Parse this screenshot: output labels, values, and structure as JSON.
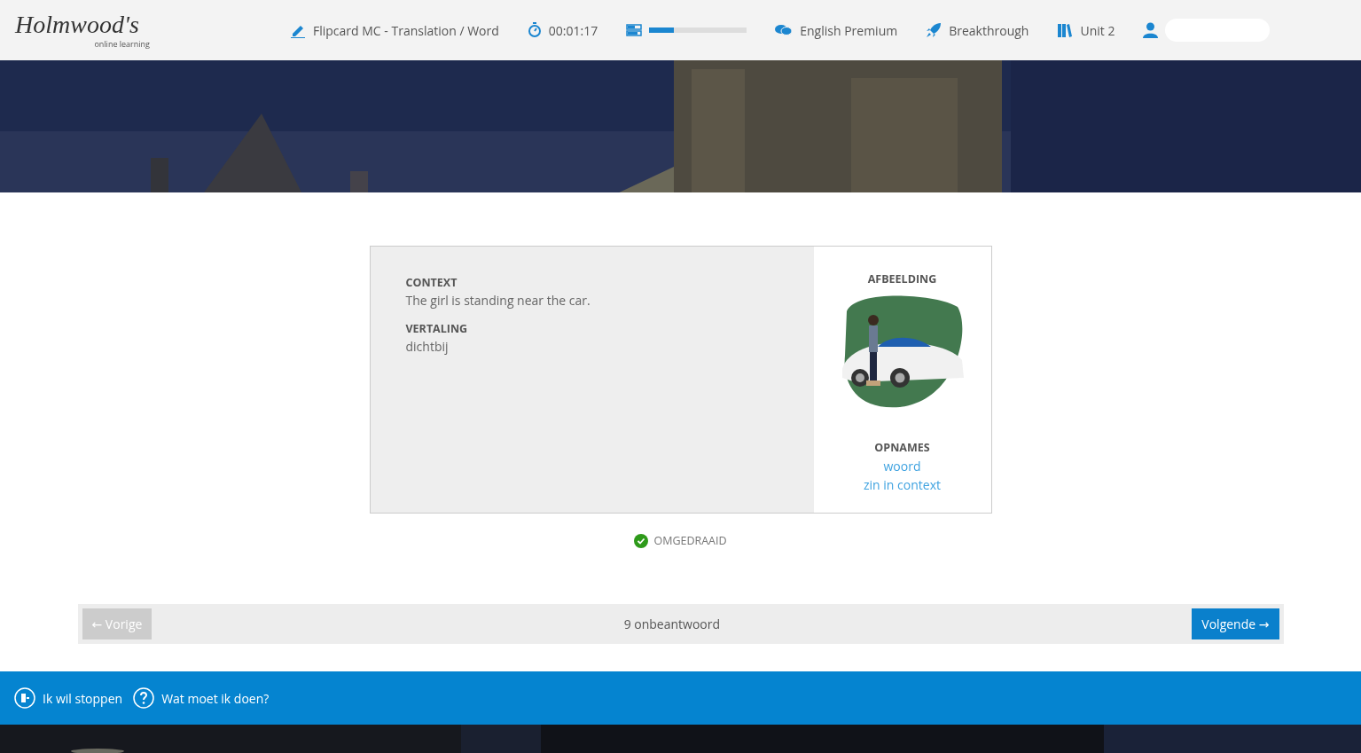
{
  "logo": {
    "name": "Holmwood's",
    "tagline": "online learning"
  },
  "header": {
    "exercise": "Flipcard MC - Translation / Word",
    "timer": "00:01:17",
    "progress": {
      "level": 0.25
    },
    "course": "English Premium",
    "level_name": "Breakthrough",
    "unit": "Unit 2",
    "user": {
      "redacted": true
    }
  },
  "card": {
    "sections": [
      {
        "heading": "CONTEXT",
        "text": "The girl is standing near the car."
      },
      {
        "heading": "VERTALING",
        "text": "dichtbij"
      }
    ],
    "image_heading": "AFBEELDING",
    "recordings_heading": "OPNAMES",
    "recordings": [
      "woord",
      "zin in context"
    ]
  },
  "status": {
    "label": "OMGEDRAAID",
    "checked": true
  },
  "navigation": {
    "previous": {
      "label": "← Vorige",
      "disabled": true
    },
    "counter": "9 onbeantwoord",
    "next": {
      "label": "Volgende →",
      "disabled": false
    }
  },
  "footer": {
    "links": [
      {
        "kind": "stop",
        "label": "Ik wil stoppen"
      },
      {
        "kind": "help",
        "label": "Wat moet ik doen?"
      }
    ]
  }
}
